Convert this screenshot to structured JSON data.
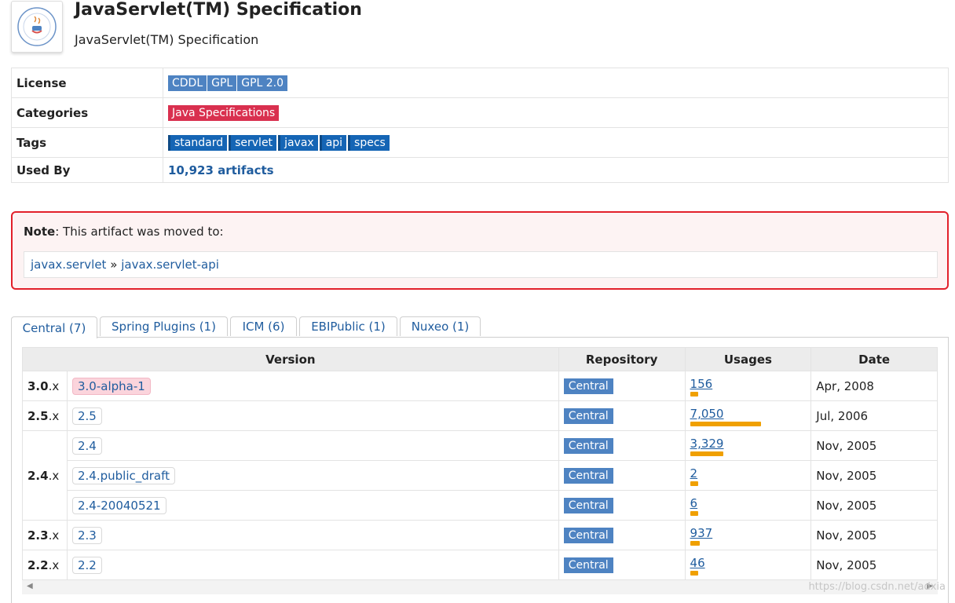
{
  "header": {
    "title": "JavaServlet(TM) Specification",
    "subtitle": "JavaServlet(TM) Specification",
    "logo_icon": "java-community-process-logo"
  },
  "info": {
    "license_label": "License",
    "licenses": [
      "CDDL",
      "GPL",
      "GPL 2.0"
    ],
    "categories_label": "Categories",
    "categories": [
      "Java Specifications"
    ],
    "tags_label": "Tags",
    "tags": [
      "standard",
      "servlet",
      "javax",
      "api",
      "specs"
    ],
    "used_by_label": "Used By",
    "used_by_value": "10,923 artifacts"
  },
  "note": {
    "label": "Note",
    "text": ": This artifact was moved to:",
    "group": "javax.servlet",
    "separator": "»",
    "artifact": "javax.servlet-api"
  },
  "tabs": [
    "Central (7)",
    "Spring Plugins (1)",
    "ICM (6)",
    "EBIPublic (1)",
    "Nuxeo (1)"
  ],
  "table": {
    "headers": [
      "Version",
      "Repository",
      "Usages",
      "Date"
    ],
    "rows": [
      {
        "minor": "3.0",
        "suffix": ".x",
        "version": "3.0-alpha-1",
        "repo": "Central",
        "usages": "156",
        "usage_value": 156,
        "date": "Apr, 2008"
      },
      {
        "minor": "2.5",
        "suffix": ".x",
        "version": "2.5",
        "repo": "Central",
        "usages": "7,050",
        "usage_value": 7050,
        "date": "Jul, 2006"
      },
      {
        "minor": "2.4",
        "suffix": ".x",
        "version": "2.4",
        "repo": "Central",
        "usages": "3,329",
        "usage_value": 3329,
        "date": "Nov, 2005"
      },
      {
        "minor": "",
        "suffix": "",
        "version": "2.4.public_draft",
        "repo": "Central",
        "usages": "2",
        "usage_value": 2,
        "date": "Nov, 2005"
      },
      {
        "minor": "",
        "suffix": "",
        "version": "2.4-20040521",
        "repo": "Central",
        "usages": "6",
        "usage_value": 6,
        "date": "Nov, 2005"
      },
      {
        "minor": "2.3",
        "suffix": ".x",
        "version": "2.3",
        "repo": "Central",
        "usages": "937",
        "usage_value": 937,
        "date": "Nov, 2005"
      },
      {
        "minor": "2.2",
        "suffix": ".x",
        "version": "2.2",
        "repo": "Central",
        "usages": "46",
        "usage_value": 46,
        "date": "Nov, 2005"
      }
    ]
  },
  "watermark": "https://blog.csdn.net/adxia",
  "colors": {
    "license_badge": "#4e83c2",
    "category_badge": "#d9304f",
    "tag_badge": "#1565b5",
    "usage_bar": "#f0a000",
    "note_border": "#e2202a"
  }
}
